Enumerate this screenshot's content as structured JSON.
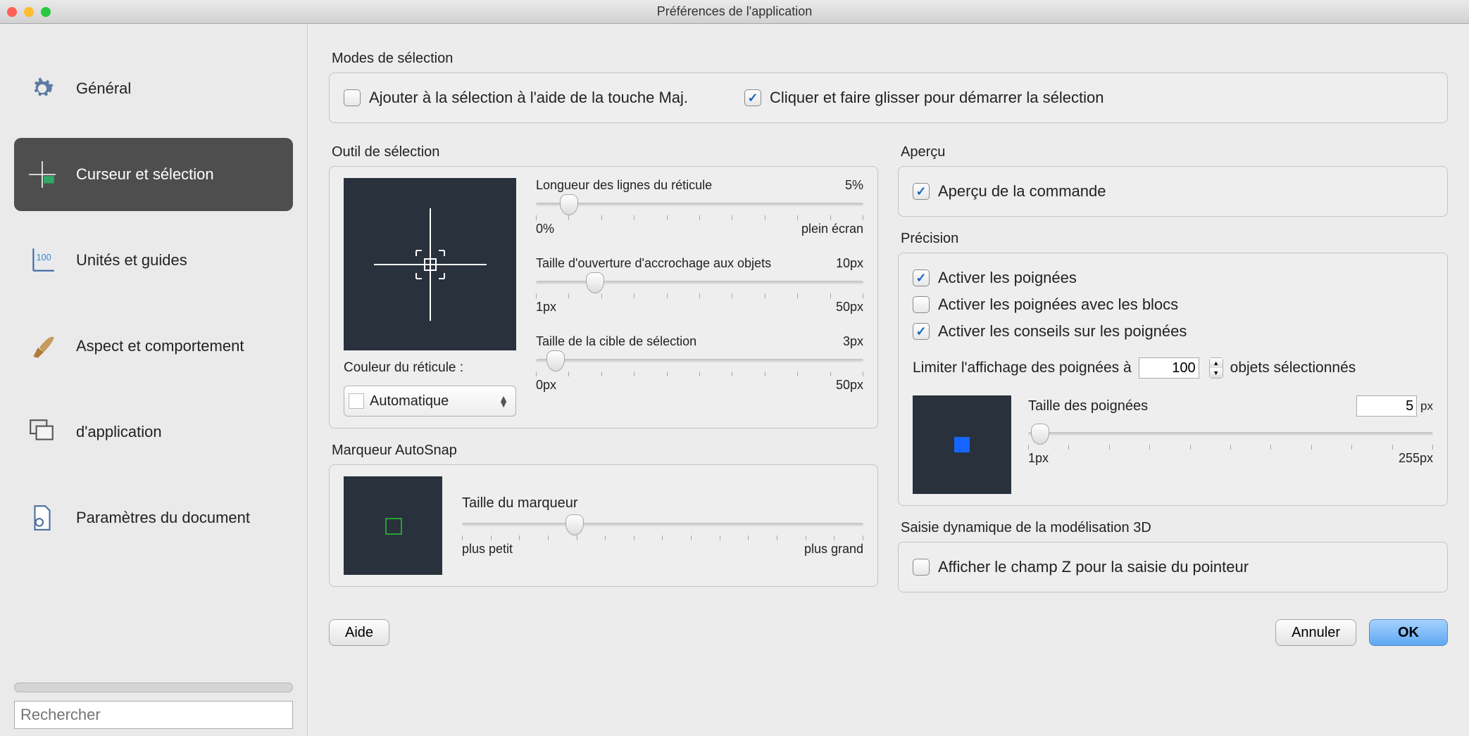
{
  "window": {
    "title": "Préférences de l'application"
  },
  "sidebar": {
    "items": [
      {
        "label": "Général"
      },
      {
        "label": "Curseur et sélection"
      },
      {
        "label": "Unités et guides"
      },
      {
        "label": "Aspect et comportement"
      },
      {
        "label": "d'application"
      },
      {
        "label": "Paramètres du document"
      }
    ],
    "search_placeholder": "Rechercher"
  },
  "modes": {
    "title": "Modes de sélection",
    "add_shift": "Ajouter à la sélection à l'aide de la touche Maj.",
    "click_drag": "Cliquer et faire glisser pour démarrer la sélection",
    "add_shift_checked": false,
    "click_drag_checked": true
  },
  "tool": {
    "title": "Outil de sélection",
    "crosshair_color_label": "Couleur du réticule :",
    "crosshair_color_value": "Automatique",
    "sliders": {
      "reticle": {
        "label": "Longueur des lignes du réticule",
        "value": "5%",
        "min": "0%",
        "max": "plein écran",
        "percent": 10
      },
      "snap": {
        "label": "Taille d'ouverture d'accrochage aux objets",
        "value": "10px",
        "min": "1px",
        "max": "50px",
        "percent": 18
      },
      "target": {
        "label": "Taille de la cible de sélection",
        "value": "3px",
        "min": "0px",
        "max": "50px",
        "percent": 6
      }
    }
  },
  "autosnap": {
    "title": "Marqueur AutoSnap",
    "slider": {
      "label": "Taille du marqueur",
      "min": "plus petit",
      "max": "plus grand",
      "percent": 28
    }
  },
  "preview": {
    "title": "Aperçu",
    "command_preview": "Aperçu de la commande",
    "checked": true
  },
  "precision": {
    "title": "Précision",
    "enable_grips": "Activer les poignées",
    "enable_grips_blocks": "Activer les poignées avec les blocs",
    "enable_grip_tips": "Activer les conseils sur les poignées",
    "enable_grips_checked": true,
    "enable_grips_blocks_checked": false,
    "enable_grip_tips_checked": true,
    "limit_label_pre": "Limiter l'affichage des poignées à",
    "limit_value": "100",
    "limit_label_post": "objets sélectionnés",
    "grip_size_label": "Taille des poignées",
    "grip_size_value": "5",
    "grip_size_unit": "px",
    "grip_slider": {
      "min": "1px",
      "max": "255px",
      "percent": 3
    }
  },
  "dyn3d": {
    "title": "Saisie dynamique de la modélisation 3D",
    "show_z": "Afficher le champ Z pour la saisie du pointeur",
    "checked": false
  },
  "footer": {
    "help": "Aide",
    "cancel": "Annuler",
    "ok": "OK"
  }
}
